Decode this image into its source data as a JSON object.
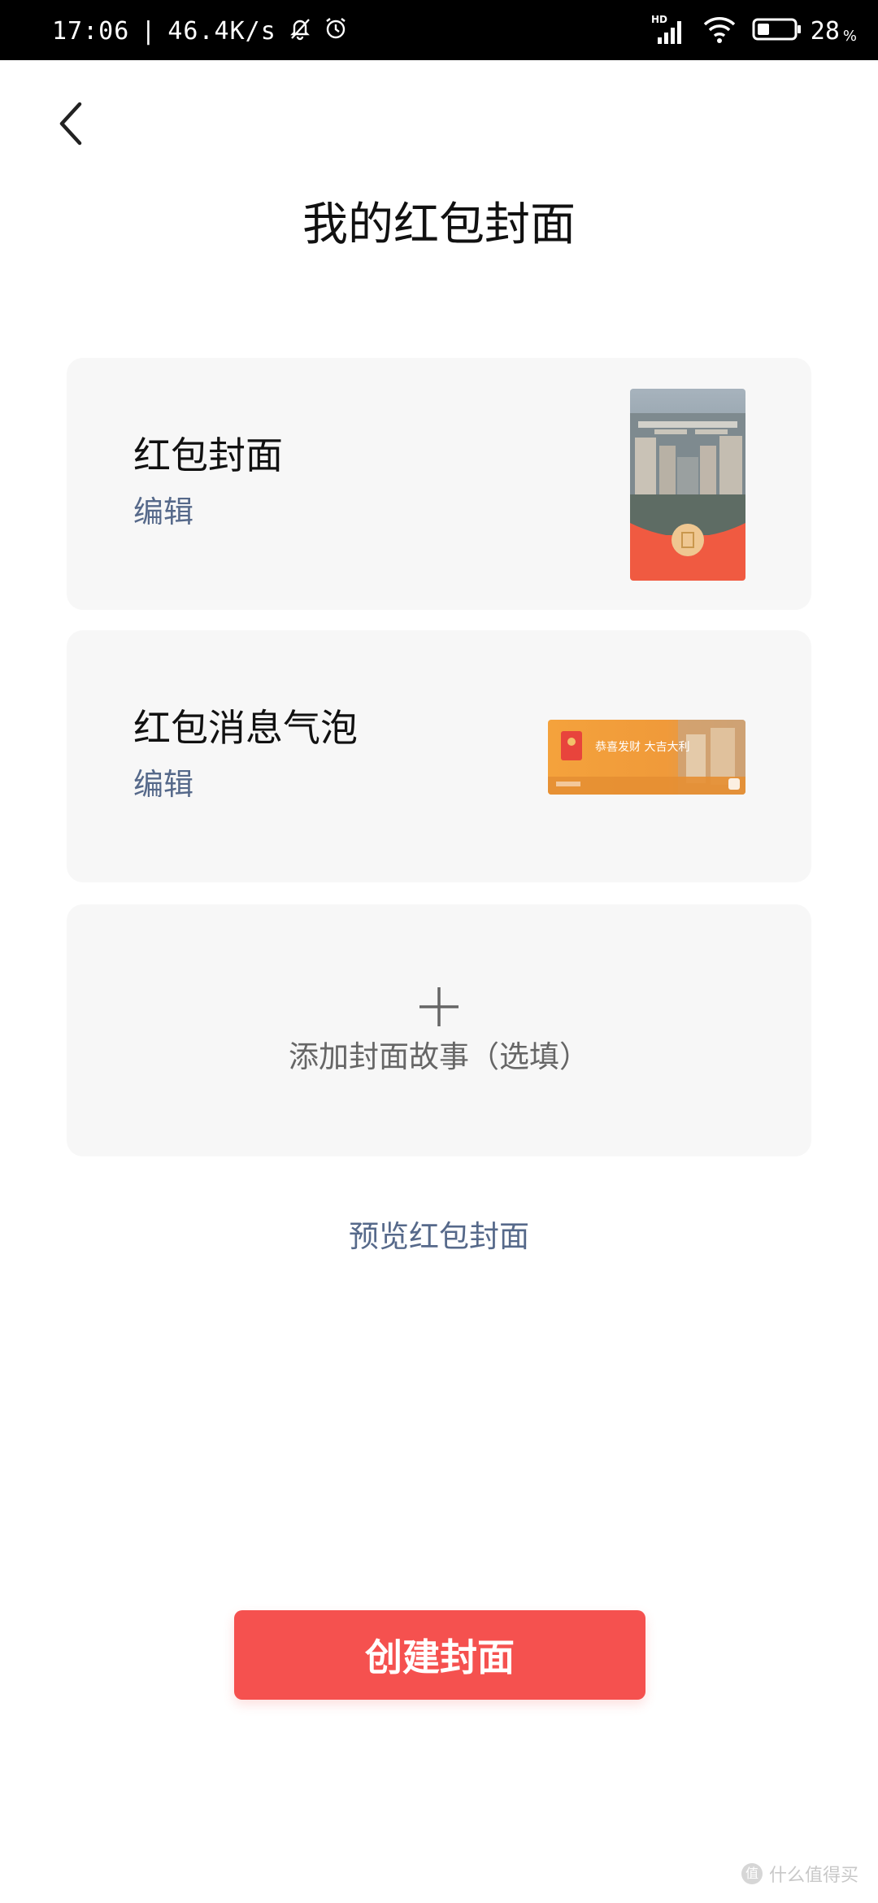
{
  "status_bar": {
    "time": "17:06",
    "network_speed": "46.4K/s",
    "network_type": "HD",
    "battery_level": "28",
    "battery_unit": "%"
  },
  "header": {
    "title": "我的红包封面"
  },
  "cards": [
    {
      "title": "红包封面",
      "action": "编辑"
    },
    {
      "title": "红包消息气泡",
      "action": "编辑",
      "bubble_text": "恭喜发财 大吉大利"
    },
    {
      "add_label": "添加封面故事（选填）"
    }
  ],
  "preview_link": "预览红包封面",
  "create_button": "创建封面",
  "watermark": "什么值得买",
  "colors": {
    "accent_red": "#f5514f",
    "link_blue_gray": "#56698a",
    "card_bg": "#f7f7f7"
  }
}
